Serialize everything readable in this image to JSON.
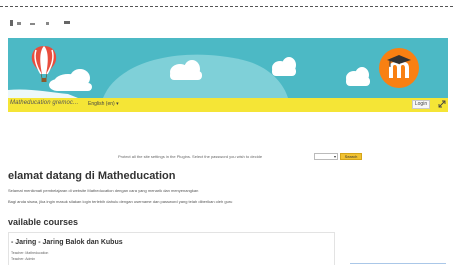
{
  "header": {
    "site_name": "Matheducation gremoc...",
    "language_menu": "English (en) ▾",
    "login_label": "Login"
  },
  "search": {
    "text": "Protect all the site settings in the Plugins. Select the password you wish to decide",
    "select_value": "",
    "button_label": "Search"
  },
  "main": {
    "title": "elamat datang di Matheducation",
    "intro_line1": "Selamat menikmati pembelajaran di website Matheducation dengan cara yang menarik dan menyenangkan",
    "intro_line2": "Bagi anda siswa, jika ingin masuk silakan login terlebih dahulu dengan username dan password yang telah diberikan oleh guru",
    "courses_heading": "vailable courses"
  },
  "course": {
    "title": "- Jaring - Jaring Balok dan Kubus",
    "teacher1": "Teacher: Matheducation",
    "teacher2": "Teacher: Admin"
  },
  "colors": {
    "banner_bg": "#4cb9c5",
    "navbar_bg": "#f5e536",
    "logo_orange": "#f98012",
    "balloon_red": "#e84d3d",
    "search_button": "#f1c232"
  },
  "icons": {
    "balloon": "hot-air-balloon-icon",
    "logo": "moodle-logo-icon",
    "expand": "expand-icon",
    "dropdown": "chevron-down-icon"
  }
}
